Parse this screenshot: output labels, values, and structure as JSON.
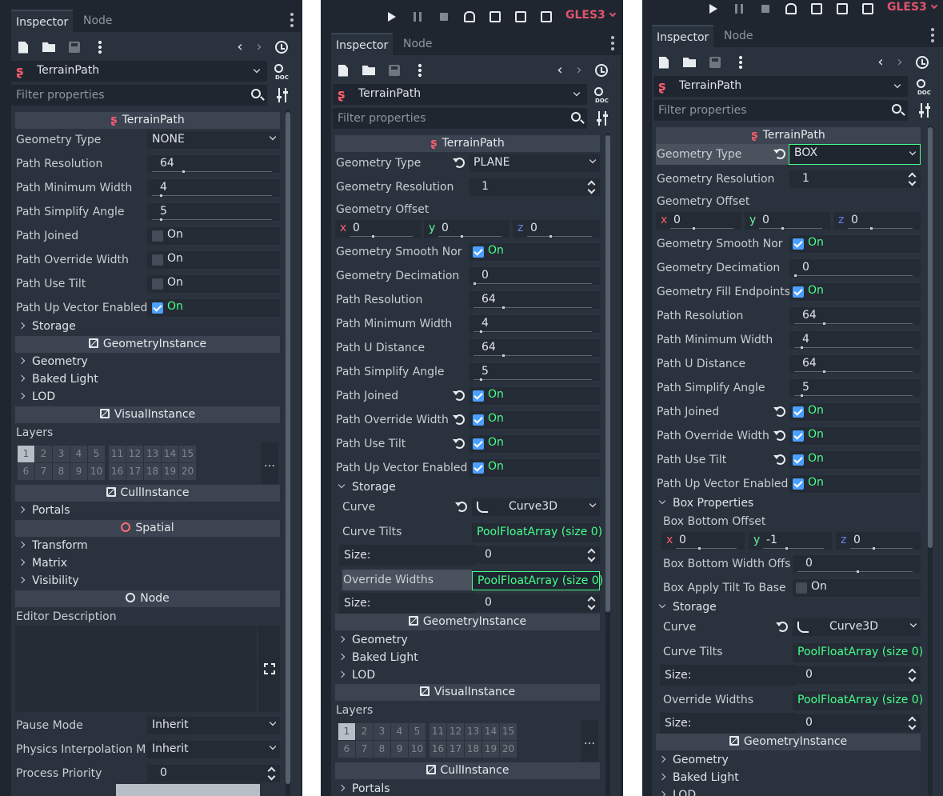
{
  "tabs": {
    "inspector": "Inspector",
    "node": "Node"
  },
  "node_name": "TerrainPath",
  "filter_placeholder": "Filter properties",
  "toolbar": {
    "renderer": "GLES3"
  },
  "on": "On",
  "sections": {
    "terrainpath": "TerrainPath",
    "geometryinstance": "GeometryInstance",
    "visualinstance": "VisualInstance",
    "cullinstance": "CullInstance",
    "spatial": "Spatial",
    "node": "Node"
  },
  "layers": {
    "label": "Layers",
    "top": [
      "1",
      "2",
      "3",
      "4",
      "5",
      "11",
      "12",
      "13",
      "14",
      "15"
    ],
    "bottom": [
      "6",
      "7",
      "8",
      "9",
      "10",
      "16",
      "17",
      "18",
      "19",
      "20"
    ],
    "more": "…"
  },
  "panel1": {
    "props": [
      {
        "label": "Geometry Type",
        "value": "NONE"
      },
      {
        "label": "Path Resolution",
        "value": "64"
      },
      {
        "label": "Path Minimum Width",
        "value": "4"
      },
      {
        "label": "Path Simplify Angle",
        "value": "5"
      },
      {
        "label": "Path Joined"
      },
      {
        "label": "Path Override Width"
      },
      {
        "label": "Path Use Tilt"
      },
      {
        "label": "Path Up Vector Enabled"
      }
    ],
    "groups": {
      "storage": "Storage",
      "geometry": "Geometry",
      "baked_light": "Baked Light",
      "lod": "LOD",
      "portals": "Portals",
      "transform": "Transform",
      "matrix": "Matrix",
      "visibility": "Visibility"
    },
    "editor_description": "Editor Description",
    "pause_mode": {
      "label": "Pause Mode",
      "value": "Inherit"
    },
    "physics_interp": {
      "label": "Physics Interpolation M",
      "value": "Inherit"
    },
    "process_priority": {
      "label": "Process Priority",
      "value": "0"
    }
  },
  "panel2": {
    "geometry_type": {
      "label": "Geometry Type",
      "value": "PLANE"
    },
    "geometry_resolution": {
      "label": "Geometry Resolution",
      "value": "1"
    },
    "geometry_offset": {
      "label": "Geometry Offset",
      "x": "0",
      "y": "0",
      "z": "0"
    },
    "smooth": {
      "label": "Geometry Smooth Nor"
    },
    "decimation": {
      "label": "Geometry Decimation",
      "value": "0"
    },
    "path_resolution": {
      "label": "Path Resolution",
      "value": "64"
    },
    "path_min_width": {
      "label": "Path Minimum Width",
      "value": "4"
    },
    "path_u_distance": {
      "label": "Path U Distance",
      "value": "64"
    },
    "path_simplify": {
      "label": "Path Simplify Angle",
      "value": "5"
    },
    "path_joined": {
      "label": "Path Joined"
    },
    "path_override": {
      "label": "Path Override Width"
    },
    "path_use_tilt": {
      "label": "Path Use Tilt"
    },
    "path_up": {
      "label": "Path Up Vector Enabled"
    },
    "storage": "Storage",
    "curve": {
      "label": "Curve",
      "value": "Curve3D"
    },
    "curve_tilts": {
      "label": "Curve Tilts",
      "value": "PoolFloatArray (size 0)"
    },
    "size1": {
      "label": "Size:",
      "value": "0"
    },
    "override_widths": {
      "label": "Override Widths",
      "value": "PoolFloatArray (size 0)"
    },
    "size2": {
      "label": "Size:",
      "value": "0"
    },
    "groups": {
      "geometry": "Geometry",
      "baked_light": "Baked Light",
      "lod": "LOD",
      "portals": "Portals"
    }
  },
  "panel3": {
    "geometry_type": {
      "label": "Geometry Type",
      "value": "BOX"
    },
    "geometry_resolution": {
      "label": "Geometry Resolution",
      "value": "1"
    },
    "geometry_offset": {
      "label": "Geometry Offset",
      "x": "0",
      "y": "0",
      "z": "0"
    },
    "smooth": {
      "label": "Geometry Smooth Nor"
    },
    "decimation": {
      "label": "Geometry Decimation",
      "value": "0"
    },
    "fill": {
      "label": "Geometry Fill Endpoints"
    },
    "path_resolution": {
      "label": "Path Resolution",
      "value": "64"
    },
    "path_min_width": {
      "label": "Path Minimum Width",
      "value": "4"
    },
    "path_u_distance": {
      "label": "Path U Distance",
      "value": "64"
    },
    "path_simplify": {
      "label": "Path Simplify Angle",
      "value": "5"
    },
    "path_joined": {
      "label": "Path Joined"
    },
    "path_override": {
      "label": "Path Override Width"
    },
    "path_use_tilt": {
      "label": "Path Use Tilt"
    },
    "path_up": {
      "label": "Path Up Vector Enabled"
    },
    "box_props": "Box Properties",
    "box_bottom_offset": {
      "label": "Box Bottom Offset",
      "x": "0",
      "y": "-1",
      "z": "0"
    },
    "box_bottom_width": {
      "label": "Box Bottom Width Offs",
      "value": "0"
    },
    "box_tilt": {
      "label": "Box Apply Tilt To Base"
    },
    "storage": "Storage",
    "curve": {
      "label": "Curve",
      "value": "Curve3D"
    },
    "curve_tilts": {
      "label": "Curve Tilts",
      "value": "PoolFloatArray (size 0)"
    },
    "size1": {
      "label": "Size:",
      "value": "0"
    },
    "override_widths": {
      "label": "Override Widths",
      "value": "PoolFloatArray (size 0)"
    },
    "size2": {
      "label": "Size:",
      "value": "0"
    },
    "groups": {
      "geometry": "Geometry",
      "baked_light": "Baked Light",
      "lod": "LOD"
    }
  }
}
